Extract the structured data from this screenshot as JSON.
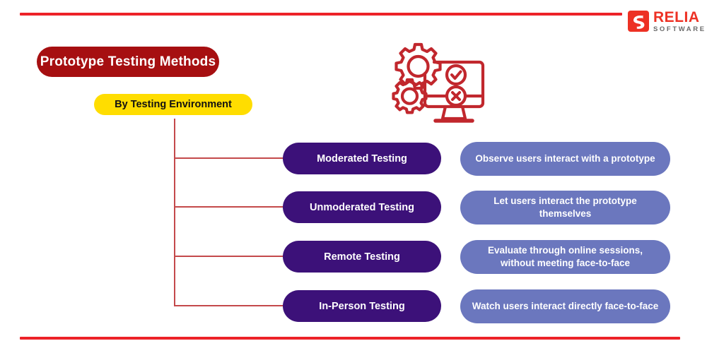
{
  "brand": {
    "logo_word": "RELIA",
    "logo_sub": "SOFTWARE",
    "logo_mark_icon": "relia-s-mark-icon",
    "accent_red": "#ED2228",
    "logo_orange": "#ED3124"
  },
  "header": {
    "title": "Prototype Testing Methods",
    "subtitle": "By Testing Environment",
    "title_bg": "#A60F11",
    "subtitle_bg": "#FFDD00"
  },
  "illustration": {
    "icon": "monitor-with-gears-check-cross-icon",
    "color": "#C1272D",
    "parts": [
      "gear-large-icon",
      "gear-small-icon",
      "monitor-icon",
      "check-circle-icon",
      "cross-circle-icon"
    ]
  },
  "colors": {
    "method_bg": "#3C1179",
    "desc_bg": "#6B77BE",
    "connector": "#C4494B"
  },
  "rows": [
    {
      "method": "Moderated Testing",
      "description": "Observe users interact with a prototype"
    },
    {
      "method": "Unmoderated Testing",
      "description": "Let users interact the prototype themselves"
    },
    {
      "method": "Remote Testing",
      "description": "Evaluate through online sessions, without meeting face-to-face"
    },
    {
      "method": "In-Person Testing",
      "description": "Watch users interact directly face-to-face"
    }
  ]
}
